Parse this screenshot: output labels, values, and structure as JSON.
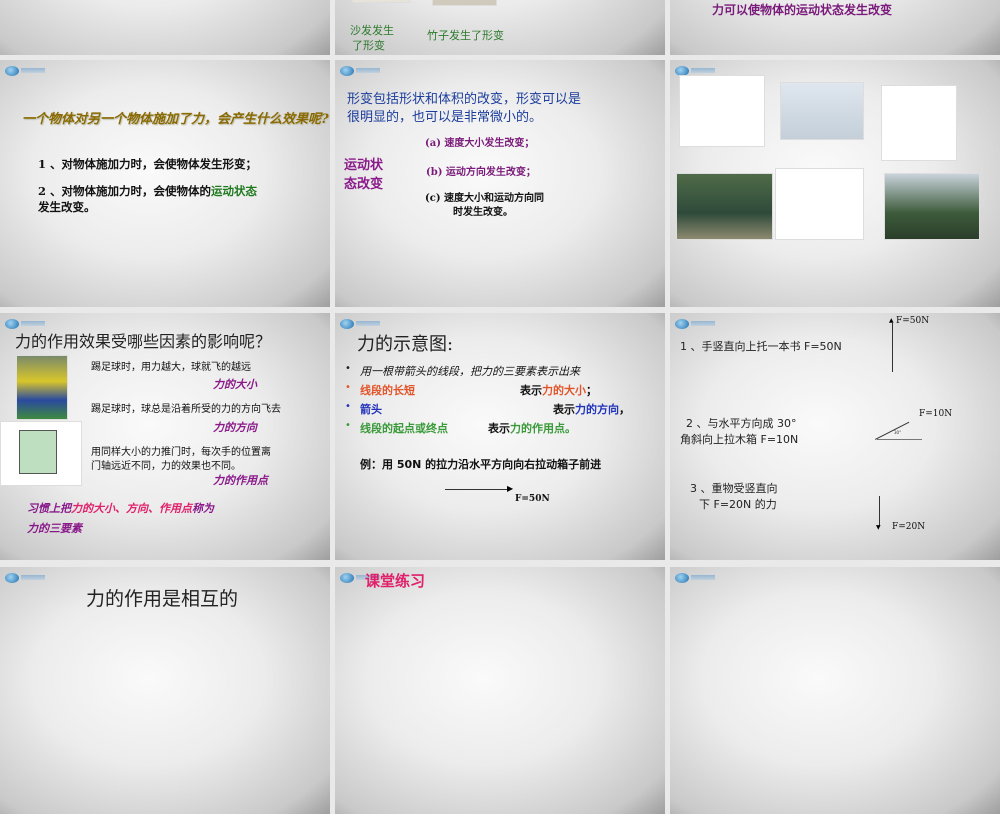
{
  "slides": [
    {
      "id": "s0a"
    },
    {
      "captions": [
        "沙发发生",
        "了形变",
        "竹子发生了形变"
      ]
    },
    {
      "title": "力可以使物体的运动状态发生改变"
    },
    {
      "title": "一个物体对另一个物体施加了力，会产生什么效果呢?",
      "line1": "1 、对物体施加力时，会使物体发生形变；",
      "line2_prefix": "2 、对物体施加力时，会使物体的",
      "line2_highlight": "运动状态",
      "line2_end": "发生改变。"
    },
    {
      "intro1": "形变包括形状和体积的改变，形变可以是",
      "intro2": "很明显的，也可以是非常微小的。",
      "side1": "运动状",
      "side2": "态改变",
      "a": "(a) 速度大小发生改变；",
      "b": "(b) 运动方向发生改变；",
      "c1": "(c) 速度大小和运动方向同",
      "c2": "时发生改变。"
    },
    {
      "images": [
        "panda-bamboo",
        "pole-vault",
        "header-cartoon",
        "baseball-pitcher",
        "rolling-balls",
        "goalkeeper"
      ]
    },
    {
      "title": "力的作用效果受哪些因素的影响呢？",
      "p1": "踢足球时，用力越大，球就飞的越远",
      "k1": "力的大小",
      "p2": "踢足球时，球总是沿着所受的力的方向飞去",
      "k2": "力的方向",
      "p3a": "用同样大小的力推门时，每次手的位置离",
      "p3b": "门轴远近不同，力的效果也不同。",
      "k3": "力的作用点",
      "sum_a": "习惯上把",
      "sum_b": "力的大小、方向、作用点",
      "sum_c": "称为",
      "sum_d": "力的三要素"
    },
    {
      "title": "力的示意图:",
      "b1": "用一根带箭头的线段，把力的三要素表示出来",
      "b2": "线段的长短",
      "b2r_a": "表示",
      "b2r_b": "力的大小",
      "b2r_c": "；",
      "b3": "箭头",
      "b3r_a": "表示",
      "b3r_b": "力的方向",
      "b3r_c": "，",
      "b4": "线段的起点或终点",
      "b4r_a": "表示",
      "b4r_b": "力的作用点。",
      "example": "例：用 50N 的拉力沿水平方向向右拉动箱子前进",
      "force": "F=50N"
    },
    {
      "q1": "1 、手竖直向上托一本书 F=50N",
      "f1": "F=50N",
      "q2a": "2 、与水平方向成 30°",
      "q2b": "角斜向上拉木箱 F=10N",
      "f2": "F=10N",
      "angle": "30°",
      "q3a": "3 、重物受竖直向",
      "q3b": "下 F=20N 的力",
      "f3": "F=20N"
    },
    {
      "title": "力的作用是相互的"
    },
    {
      "title": "课堂练习"
    },
    {
      "id": "s11"
    }
  ],
  "colors": {
    "olive": "#8a6a00",
    "green": "#1f7a1f",
    "blue": "#1a3c9c",
    "purple": "#8a1a8a",
    "pink": "#e0206a",
    "orange": "#e2552a"
  }
}
